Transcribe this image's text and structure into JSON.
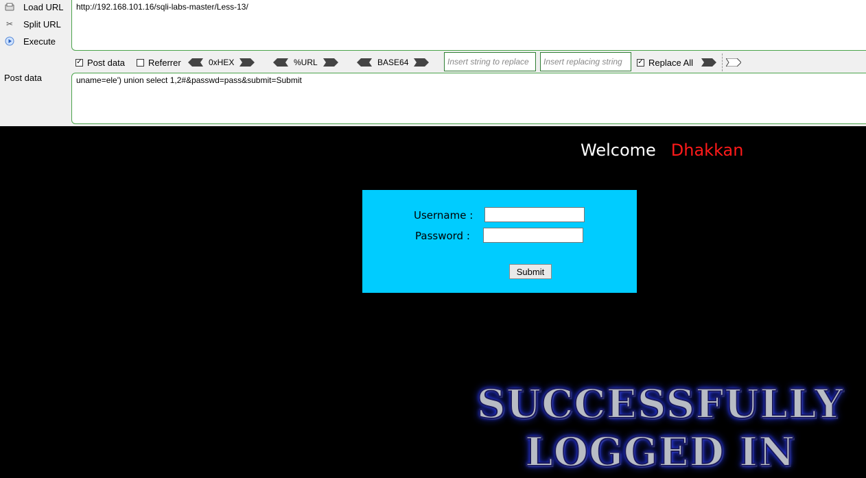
{
  "sidebar": {
    "load_url": "Load URL",
    "split_url": "Split URL",
    "execute": "Execute",
    "post_data_label": "Post data"
  },
  "url_field": {
    "value": "http://192.168.101.16/sqli-labs-master/Less-13/"
  },
  "options": {
    "post_data": {
      "label": "Post data",
      "checked": true
    },
    "referrer": {
      "label": "Referrer",
      "checked": false
    },
    "hex": "0xHEX",
    "url": "%URL",
    "base64": "BASE64",
    "replace_find_placeholder": "Insert string to replace",
    "replace_with_placeholder": "Insert replacing string",
    "replace_all": {
      "label": "Replace All",
      "checked": true
    }
  },
  "post_field": {
    "value": "uname=ele') union select 1,2#&passwd=pass&submit=Submit"
  },
  "page": {
    "welcome": "Welcome",
    "name": "Dhakkan",
    "username_label": "Username :",
    "password_label": "Password :",
    "submit_label": "Submit",
    "banner_line1": "SUCCESSFULLY",
    "banner_line2": "LOGGED IN"
  },
  "colors": {
    "accent_green": "#4aa34a",
    "login_box": "#00ccff",
    "name_red": "#ff1a1a"
  }
}
